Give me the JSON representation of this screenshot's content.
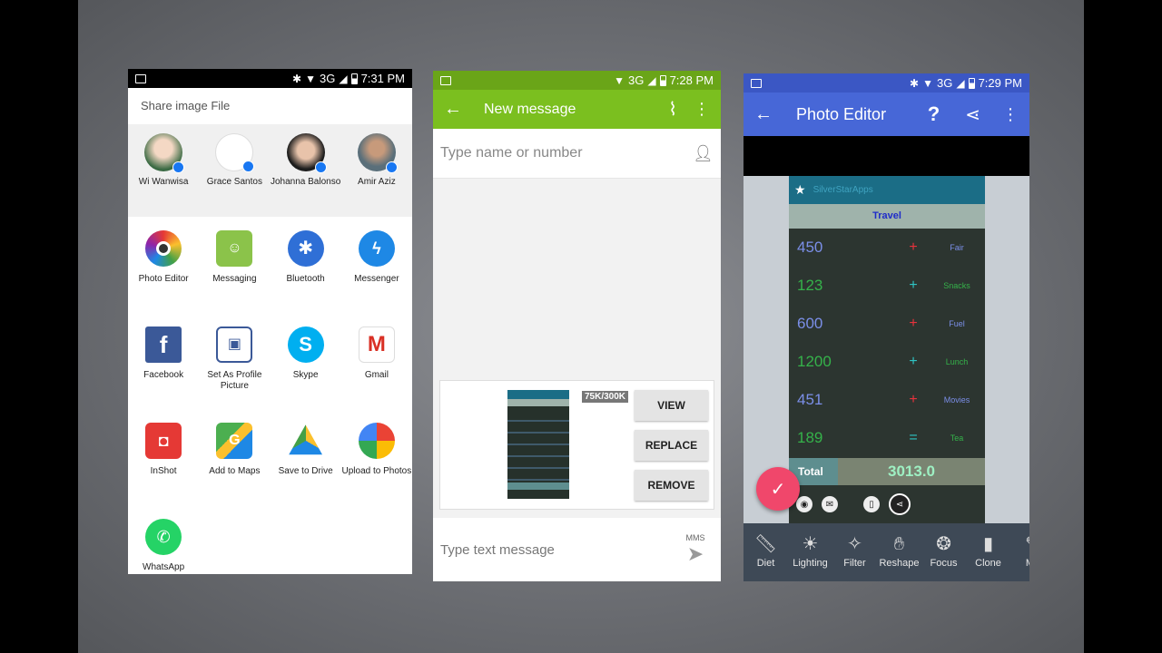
{
  "p1": {
    "status_time": "7:31 PM",
    "net": "3G",
    "share_title": "Share image File",
    "contacts": [
      {
        "name": "Wi Wanwisa"
      },
      {
        "name": "Grace Santos"
      },
      {
        "name": "Johanna Balonso"
      },
      {
        "name": "Amir Aziz"
      }
    ],
    "apps": [
      {
        "label": "Photo Editor",
        "icon": "photo-editor-icon",
        "color": "#ffffff"
      },
      {
        "label": "Messaging",
        "icon": "messaging-icon",
        "color": "#8bc34a"
      },
      {
        "label": "Bluetooth",
        "icon": "bluetooth-icon",
        "color": "#2f6fd6"
      },
      {
        "label": "Messenger",
        "icon": "messenger-icon",
        "color": "#1e88e5"
      },
      {
        "label": "Facebook",
        "icon": "facebook-icon",
        "color": "#3b5998"
      },
      {
        "label": "Set As Profile Picture",
        "icon": "profile-picture-icon",
        "color": "#3b5998"
      },
      {
        "label": "Skype",
        "icon": "skype-icon",
        "color": "#00aff0"
      },
      {
        "label": "Gmail",
        "icon": "gmail-icon",
        "color": "#ffffff"
      },
      {
        "label": "InShot",
        "icon": "inshot-icon",
        "color": "#e53935"
      },
      {
        "label": "Add to Maps",
        "icon": "maps-icon",
        "color": "#4caf50"
      },
      {
        "label": "Save to Drive",
        "icon": "drive-icon",
        "color": "#ffffff"
      },
      {
        "label": "Upload to Photos",
        "icon": "photos-icon",
        "color": "#ffffff"
      },
      {
        "label": "WhatsApp",
        "icon": "whatsapp-icon",
        "color": "#25d366"
      }
    ]
  },
  "p2": {
    "status_time": "7:28 PM",
    "net": "3G",
    "title": "New message",
    "to_placeholder": "Type name or number",
    "size": "75K/300K",
    "btn_view": "VIEW",
    "btn_replace": "REPLACE",
    "btn_remove": "REMOVE",
    "msg_placeholder": "Type text message",
    "mms": "MMS"
  },
  "p3": {
    "status_time": "7:29 PM",
    "net": "3G",
    "title": "Photo Editor",
    "shot_brand": "SilverStarApps",
    "shot_heading": "Travel",
    "rows": [
      {
        "num": "450",
        "op": "+",
        "cat": "Fair",
        "color": "#7b8fe8",
        "opcolor": "#e8323c"
      },
      {
        "num": "123",
        "op": "+",
        "cat": "Snacks",
        "color": "#35b24a",
        "opcolor": "#2ec4c4"
      },
      {
        "num": "600",
        "op": "+",
        "cat": "Fuel",
        "color": "#7b8fe8",
        "opcolor": "#e8323c"
      },
      {
        "num": "1200",
        "op": "+",
        "cat": "Lunch",
        "color": "#35b24a",
        "opcolor": "#2ec4c4"
      },
      {
        "num": "451",
        "op": "+",
        "cat": "Movies",
        "color": "#7b8fe8",
        "opcolor": "#e8323c"
      },
      {
        "num": "189",
        "op": "=",
        "cat": "Tea",
        "color": "#35b24a",
        "opcolor": "#2ec4c4"
      }
    ],
    "total_label": "Total",
    "total_value": "3013.0",
    "tools": [
      {
        "label": "Diet",
        "icon": "ruler-icon"
      },
      {
        "label": "Lighting",
        "icon": "sun-icon"
      },
      {
        "label": "Filter",
        "icon": "wand-icon"
      },
      {
        "label": "Reshape",
        "icon": "hand-icon"
      },
      {
        "label": "Focus",
        "icon": "aperture-icon"
      },
      {
        "label": "Clone",
        "icon": "stamp-icon"
      },
      {
        "label": "Ma",
        "icon": "marker-icon"
      }
    ]
  }
}
